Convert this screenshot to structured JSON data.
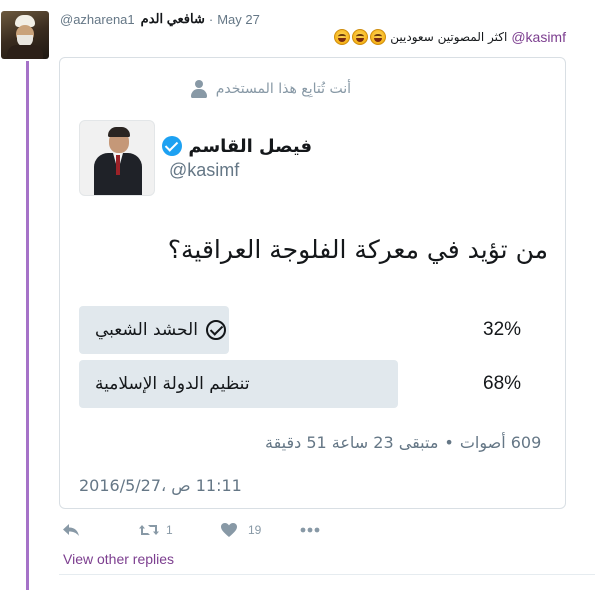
{
  "tweet": {
    "author_name": "شافعي الدم",
    "author_handle": "@azharena1",
    "date": "May 27",
    "separator": "·",
    "mention": "@kasimf",
    "reply_text": "اكثر المصوتين سعوديين",
    "emojis": [
      "face-with-tears-of-joy",
      "face-with-tears-of-joy",
      "face-with-tears-of-joy"
    ]
  },
  "quoted": {
    "follow_note": "أنت تُتابِع هذا المستخدم",
    "name": "فيصل القاسم",
    "handle": "@kasimf",
    "question": "من تؤيد في معركة الفلوجة العراقية؟",
    "poll": {
      "options": [
        {
          "label": "الحشد الشعبي",
          "percent_text": "32%",
          "value": 32,
          "selected": true
        },
        {
          "label": "تنظيم الدولة الإسلامية",
          "percent_text": "68%",
          "value": 68,
          "selected": false
        }
      ],
      "votes": "609 أصوات",
      "dot": "•",
      "remaining": "متبقى 23 ساعة 51 دقيقة"
    },
    "timestamp": "11:11 ص ،2016/5/27"
  },
  "actions": {
    "reply_icon": "reply-icon",
    "retweet_count": "1",
    "like_count": "19",
    "more_icon": "more-icon"
  },
  "view_replies": "View other replies",
  "colors": {
    "accent_purple": "#a572c8",
    "link_purple": "#7c3e8f",
    "verified_blue": "#1da1f2",
    "poll_bar": "#e1e8ed",
    "muted": "#657786"
  }
}
